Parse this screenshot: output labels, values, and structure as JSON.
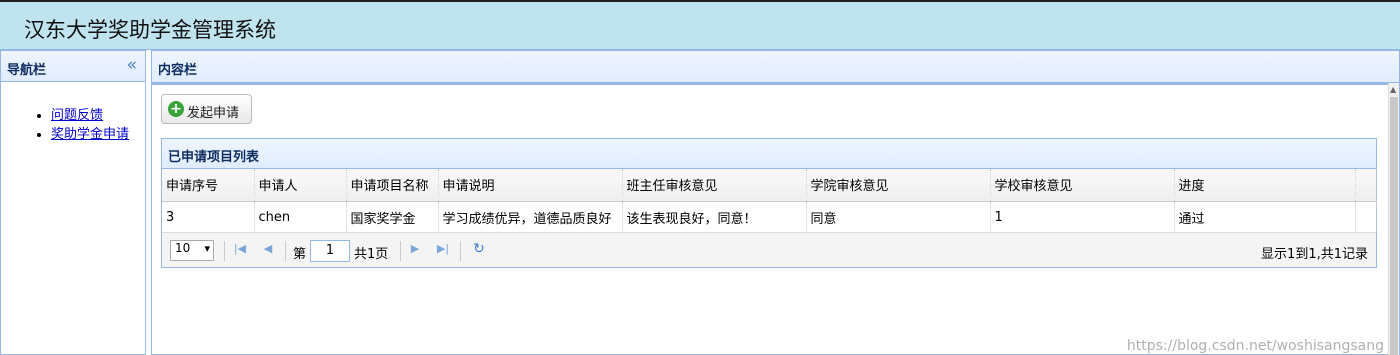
{
  "header": {
    "title": "汉东大学奖助学金管理系统"
  },
  "nav": {
    "title": "导航栏",
    "collapse_icon": "double-chevron-left-icon",
    "items": [
      {
        "label": "问题反馈"
      },
      {
        "label": "奖助学金申请"
      }
    ]
  },
  "content": {
    "title": "内容栏",
    "add_button": {
      "label": "发起申请",
      "icon": "plus-circle-icon"
    },
    "grid": {
      "title": "已申请项目列表",
      "columns": [
        "申请序号",
        "申请人",
        "申请项目名称",
        "申请说明",
        "班主任审核意见",
        "学院审核意见",
        "学校审核意见",
        "进度"
      ],
      "rows": [
        [
          "3",
          "chen",
          "国家奖学金",
          "学习成绩优异，道德品质良好",
          "该生表现良好，同意！",
          "同意",
          "1",
          "通过"
        ]
      ]
    },
    "pager": {
      "page_size": "10",
      "page_label_prefix": "第",
      "page_number": "1",
      "page_label_suffix": "共1页",
      "info": "显示1到1,共1记录"
    }
  },
  "watermark": "https://blog.csdn.net/woshisangsang",
  "colors": {
    "header_bg": "#c0e4ef",
    "panel_border": "#95b8e7",
    "link": "#0000cc"
  }
}
